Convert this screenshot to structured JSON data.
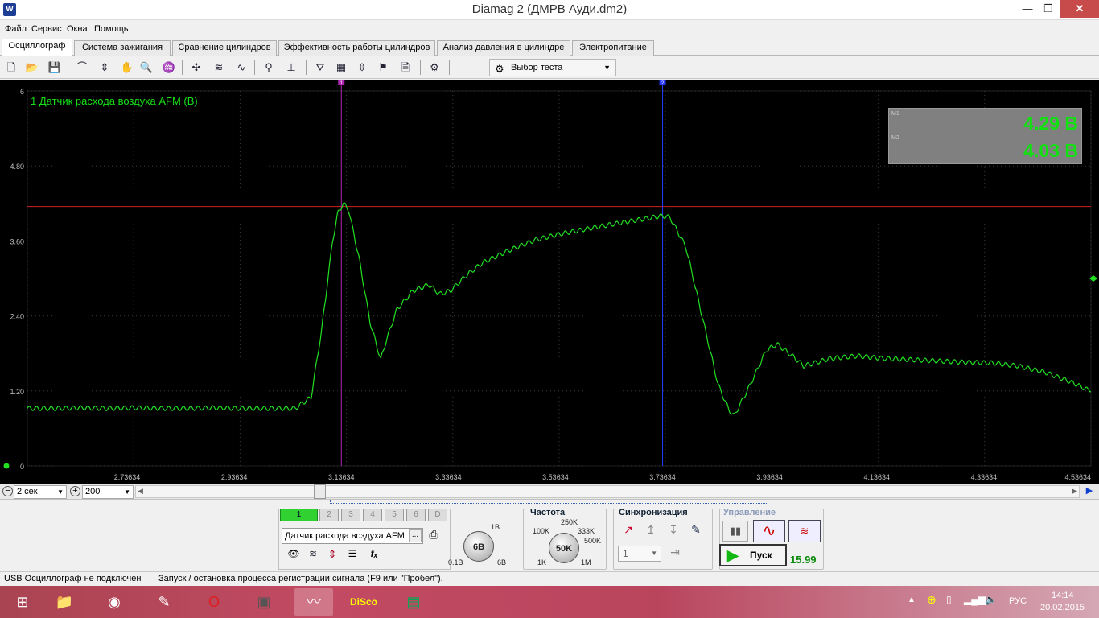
{
  "window": {
    "title": "Diamag 2 (ДМРВ Ауди.dm2)",
    "minimize": "—",
    "maximize": "❐",
    "close": "✕"
  },
  "menu": [
    "Файл",
    "Сервис",
    "Окна",
    "Помощь"
  ],
  "tabs": [
    "Осциллограф",
    "Система зажигания",
    "Сравнение цилиндров",
    "Эффективность работы цилиндров",
    "Анализ давления в цилиндре",
    "Электропитание"
  ],
  "toolbar": {
    "test_select": "Выбор теста"
  },
  "plot": {
    "channel_label": "1 Датчик расхода воздуха AFM (В)",
    "cursor1_label": "1",
    "cursor2_label": "2",
    "readout": {
      "m1_label": "M1",
      "m1_value": "4.29 В",
      "m2_label": "M2",
      "m2_value": "4.03 В"
    },
    "y_ticks": [
      "6",
      "4.80",
      "3.60",
      "2.40",
      "1.20",
      "0"
    ],
    "x_ticks": [
      "2.73634",
      "2.93634",
      "3.13634",
      "3.33634",
      "3.53634",
      "3.73634",
      "3.93634",
      "4.13634",
      "4.33634",
      "4.53634"
    ]
  },
  "chart_data": {
    "type": "line",
    "xlabel": "",
    "ylabel": "",
    "xlim": [
      2.55,
      4.53634
    ],
    "ylim": [
      0,
      6
    ],
    "series": [
      {
        "name": "1 Датчик расхода воздуха AFM (В)",
        "x": [
          2.55,
          2.6,
          2.65,
          2.7,
          2.75,
          2.8,
          2.85,
          2.9,
          2.95,
          3.0,
          3.05,
          3.08,
          3.1,
          3.12,
          3.13,
          3.14,
          3.15,
          3.17,
          3.19,
          3.21,
          3.22,
          3.24,
          3.27,
          3.3,
          3.32,
          3.34,
          3.37,
          3.4,
          3.45,
          3.5,
          3.55,
          3.6,
          3.65,
          3.7,
          3.735,
          3.75,
          3.78,
          3.81,
          3.84,
          3.86,
          3.87,
          3.9,
          3.93,
          3.95,
          3.98,
          4.0,
          4.05,
          4.1,
          4.15,
          4.2,
          4.25,
          4.3,
          4.35,
          4.4,
          4.45,
          4.5,
          4.53
        ],
        "y": [
          0.92,
          0.92,
          0.93,
          0.92,
          0.93,
          0.92,
          0.92,
          0.93,
          0.92,
          0.92,
          0.92,
          1.1,
          2.2,
          3.6,
          4.05,
          4.2,
          4.1,
          3.3,
          2.3,
          1.7,
          2.0,
          2.5,
          2.8,
          2.9,
          2.75,
          2.8,
          3.05,
          3.25,
          3.45,
          3.62,
          3.72,
          3.8,
          3.88,
          3.95,
          4.0,
          3.98,
          3.5,
          2.4,
          1.3,
          0.9,
          0.8,
          1.3,
          1.85,
          1.95,
          1.75,
          1.6,
          1.72,
          1.76,
          1.72,
          1.7,
          1.68,
          1.66,
          1.65,
          1.6,
          1.5,
          1.34,
          1.22
        ]
      }
    ],
    "cursors": {
      "m1_x": 3.13634,
      "m2_x": 3.73634,
      "level_y": 4.15
    }
  },
  "bottom": {
    "timebase": "2 сек",
    "points": "200"
  },
  "channels": {
    "buttons": [
      "1",
      "2",
      "3",
      "4",
      "5",
      "6",
      "D"
    ],
    "name": "Датчик расхода воздуха AFM",
    "ellipsis": "...",
    "fx": "fₓ"
  },
  "voltage": {
    "knob": "6В",
    "max": "1В",
    "min": "0.1В",
    "min2": "6В"
  },
  "frequency": {
    "title": "Частота",
    "knob": "50K",
    "labels": [
      "250K",
      "100K",
      "333K",
      "500K",
      "1K",
      "1M"
    ]
  },
  "sync": {
    "title": "Синхронизация",
    "select": "1"
  },
  "control": {
    "title": "Управление",
    "start": "Пуск",
    "value": "15.99"
  },
  "status": {
    "left": "USB Осциллограф не подключен",
    "right": "Запуск / остановка процесса регистрации сигнала (F9 или \"Пробел\")."
  },
  "tray": {
    "lang": "РУС",
    "time": "14:14",
    "date": "20.02.2015"
  }
}
